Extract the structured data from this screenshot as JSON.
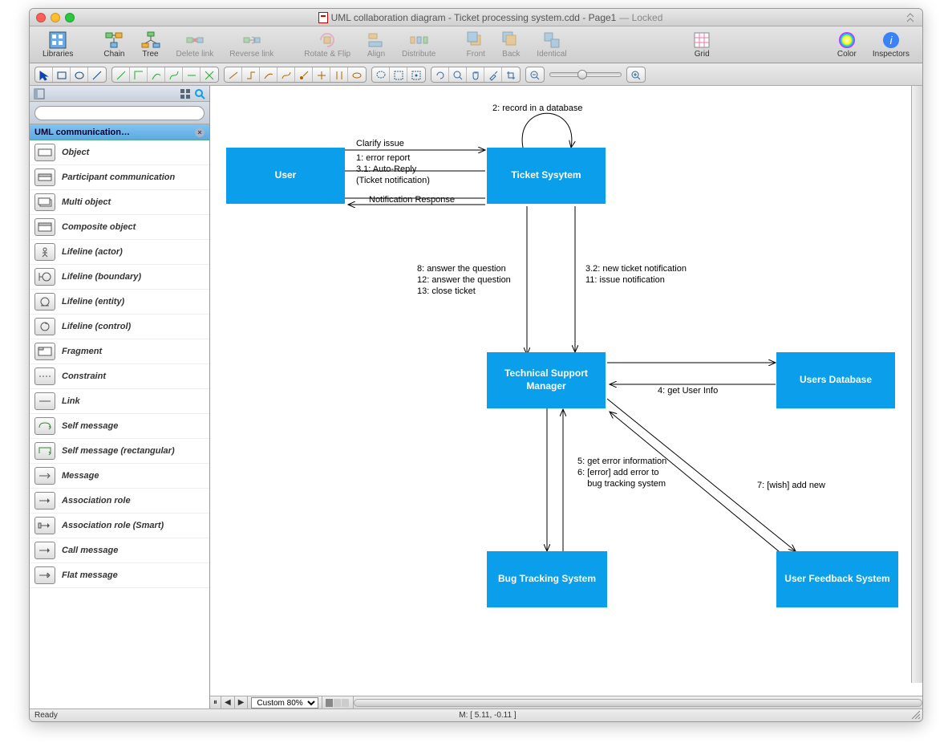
{
  "window": {
    "title_prefix": "UML collaboration diagram - Ticket processing system.cdd - Page1",
    "locked": "— Locked"
  },
  "maintoolbar": {
    "items": [
      {
        "label": "Libraries"
      },
      {
        "label": "Chain"
      },
      {
        "label": "Tree"
      },
      {
        "label": "Delete link",
        "disabled": true
      },
      {
        "label": "Reverse link",
        "disabled": true
      },
      {
        "label": "Rotate & Flip",
        "disabled": true
      },
      {
        "label": "Align",
        "disabled": true
      },
      {
        "label": "Distribute",
        "disabled": true
      },
      {
        "label": "Front",
        "disabled": true
      },
      {
        "label": "Back",
        "disabled": true
      },
      {
        "label": "Identical",
        "disabled": true
      },
      {
        "label": "Grid"
      },
      {
        "label": "Color"
      },
      {
        "label": "Inspectors"
      }
    ]
  },
  "sidebar": {
    "library_title": "UML communication…",
    "search_placeholder": "",
    "items": [
      {
        "label": "Object"
      },
      {
        "label": "Participant communication"
      },
      {
        "label": "Multi object"
      },
      {
        "label": "Composite object"
      },
      {
        "label": "Lifeline (actor)"
      },
      {
        "label": "Lifeline (boundary)"
      },
      {
        "label": "Lifeline (entity)"
      },
      {
        "label": "Lifeline (control)"
      },
      {
        "label": "Fragment"
      },
      {
        "label": "Constraint"
      },
      {
        "label": "Link"
      },
      {
        "label": "Self message"
      },
      {
        "label": "Self message (rectangular)"
      },
      {
        "label": "Message"
      },
      {
        "label": "Association role"
      },
      {
        "label": "Association role (Smart)"
      },
      {
        "label": "Call message"
      },
      {
        "label": "Flat message"
      }
    ]
  },
  "diagram": {
    "nodes": {
      "user": "User",
      "ticket": "Ticket Sysytem",
      "tsm": "Technical Support Manager",
      "usersdb": "Users Database",
      "bugtrack": "Bug Tracking System",
      "feedback": "User Feedback System"
    },
    "labels": {
      "clarify": "Clarify issue",
      "msg1": "1: error report",
      "msg31": "3.1: Auto-Reply",
      "msg31b": "(Ticket notification)",
      "notif": "Notification Response",
      "rec": "2: record in a database",
      "left8": "8: answer the question",
      "left12": "12: answer the question",
      "left13": "13: close ticket",
      "right32": "3.2: new ticket notification",
      "right11": "11: issue notification",
      "getuser": "4: get User Info",
      "mid5": "5: get error information",
      "mid6a": "6: [error] add error to",
      "mid6b": "    bug tracking system",
      "wish": "7: [wish] add new"
    }
  },
  "zoom": "Custom 80%",
  "status": {
    "ready": "Ready",
    "mouse": "M: [ 5.11, -0.11 ]"
  }
}
